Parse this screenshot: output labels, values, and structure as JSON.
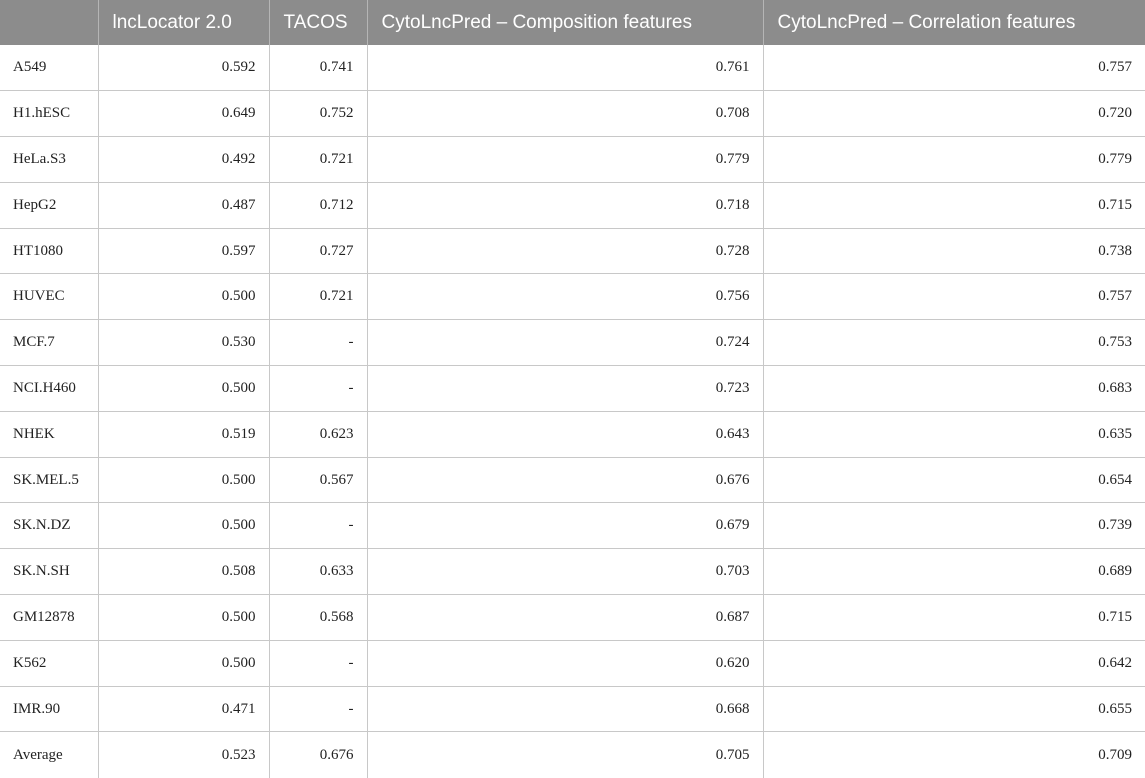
{
  "table": {
    "headers": [
      "",
      "lncLocator 2.0",
      "TACOS",
      "CytoLncPred – Composition features",
      "CytoLncPred – Correlation features"
    ],
    "rows": [
      [
        "A549",
        "0.592",
        "0.741",
        "0.761",
        "0.757"
      ],
      [
        "H1.hESC",
        "0.649",
        "0.752",
        "0.708",
        "0.720"
      ],
      [
        "HeLa.S3",
        "0.492",
        "0.721",
        "0.779",
        "0.779"
      ],
      [
        "HepG2",
        "0.487",
        "0.712",
        "0.718",
        "0.715"
      ],
      [
        "HT1080",
        "0.597",
        "0.727",
        "0.728",
        "0.738"
      ],
      [
        "HUVEC",
        "0.500",
        "0.721",
        "0.756",
        "0.757"
      ],
      [
        "MCF.7",
        "0.530",
        "-",
        "0.724",
        "0.753"
      ],
      [
        "NCI.H460",
        "0.500",
        "-",
        "0.723",
        "0.683"
      ],
      [
        "NHEK",
        "0.519",
        "0.623",
        "0.643",
        "0.635"
      ],
      [
        "SK.MEL.5",
        "0.500",
        "0.567",
        "0.676",
        "0.654"
      ],
      [
        "SK.N.DZ",
        "0.500",
        "-",
        "0.679",
        "0.739"
      ],
      [
        "SK.N.SH",
        "0.508",
        "0.633",
        "0.703",
        "0.689"
      ],
      [
        "GM12878",
        "0.500",
        "0.568",
        "0.687",
        "0.715"
      ],
      [
        "K562",
        "0.500",
        "-",
        "0.620",
        "0.642"
      ],
      [
        "IMR.90",
        "0.471",
        "-",
        "0.668",
        "0.655"
      ],
      [
        "Average",
        "0.523",
        "0.676",
        "0.705",
        "0.709"
      ]
    ]
  }
}
